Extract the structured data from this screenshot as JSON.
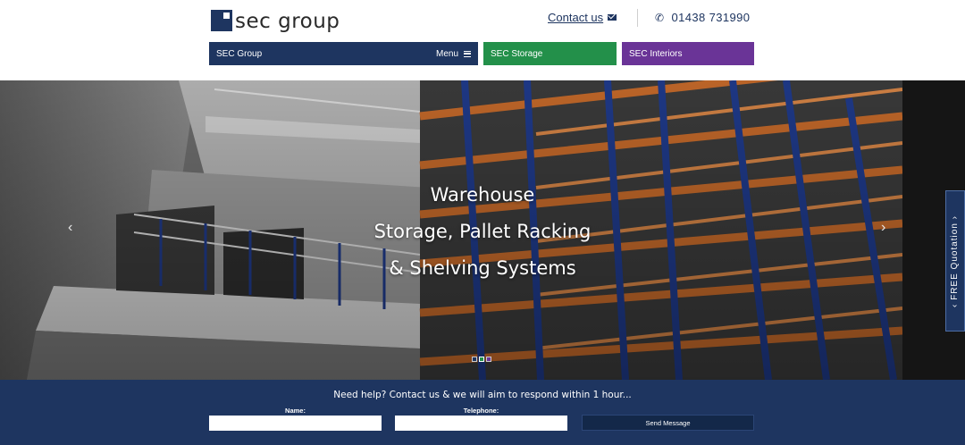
{
  "header": {
    "logo_text": "sec group",
    "contact_label": "Contact us",
    "phone": "01438 731990"
  },
  "nav": {
    "main_label": "SEC Group",
    "menu_label": "Menu",
    "storage_label": "SEC Storage",
    "interiors_label": "SEC Interiors"
  },
  "hero": {
    "lines": [
      "Warehouse",
      "Storage, Pallet Racking",
      "& Shelving Systems"
    ],
    "prev_arrow": "‹",
    "next_arrow": "›",
    "slide_count": 3,
    "active_slide": 2,
    "dot_colors": [
      "#1e3560",
      "#23904a",
      "#6a3497"
    ]
  },
  "quote_tab": {
    "label": "‹  FREE Quotation  ›"
  },
  "form": {
    "heading": "Need help? Contact us & we will aim to respond within 1 hour...",
    "name_label": "Name:",
    "telephone_label": "Telephone:",
    "send_label": "Send Message"
  },
  "colors": {
    "navy": "#1e3560",
    "green": "#23904a",
    "purple": "#6a3497",
    "racking_orange": "#c4692a",
    "racking_blue": "#1f3a8a"
  },
  "icons": [
    "mail-icon",
    "phone-icon",
    "hamburger-icon",
    "chevron-left-icon",
    "chevron-right-icon"
  ]
}
